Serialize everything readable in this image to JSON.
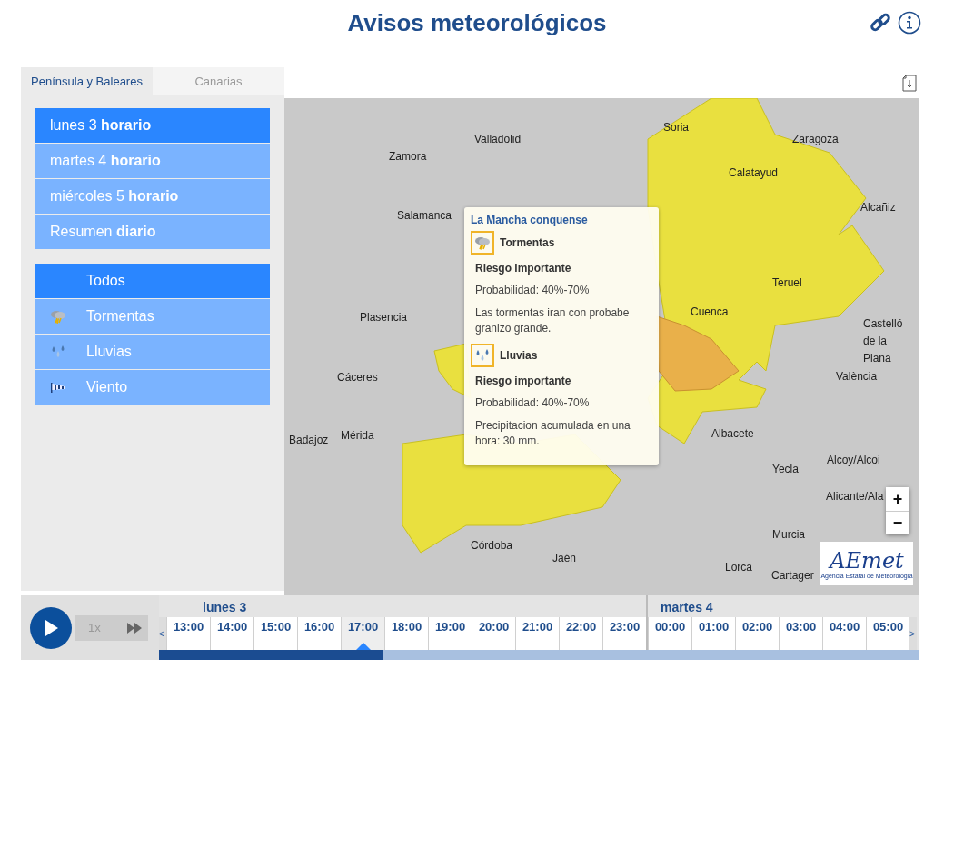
{
  "header": {
    "title": "Avisos meteorológicos"
  },
  "region_tabs": [
    {
      "label": "Península y Baleares",
      "selected": true
    },
    {
      "label": "Canarias",
      "selected": false
    }
  ],
  "day_list": [
    {
      "label": "lunes 3 **horario**",
      "selected": true
    },
    {
      "label": "martes 4 **horario**",
      "selected": false
    },
    {
      "label": "miércoles 5 **horario**",
      "selected": false
    },
    {
      "label": "Resumen **diario**",
      "selected": false
    }
  ],
  "phenomena": [
    {
      "kind": "all",
      "label": "Todos",
      "selected": true
    },
    {
      "kind": "storm",
      "label": "Tormentas",
      "selected": false
    },
    {
      "kind": "rain",
      "label": "Lluvias",
      "selected": false
    },
    {
      "kind": "wind",
      "label": "Viento",
      "selected": false
    }
  ],
  "map": {
    "cities": [
      "Soria",
      "Valladolid",
      "Zaragoza",
      "Zamora",
      "Calatayud",
      "Alcañiz",
      "Salamanca",
      "Teruel",
      "Cuenca",
      "Plasencia",
      "Castelló de la Plana",
      "València",
      "Cáceres",
      "Albacete",
      "Badajoz",
      "Mérida",
      "Alcoy/Alcoi",
      "Yecla",
      "Alicante/Ala",
      "Murcia",
      "Córdoba",
      "Jaén",
      "Lorca",
      "Cartager"
    ],
    "popup": {
      "title": "La Mancha conquense",
      "warnings": [
        {
          "kind": "storm",
          "name": "Tormentas",
          "risk": "Riesgo importante",
          "probability": "Probabilidad: 40%-70%",
          "description": "Las tormentas iran con probabe granizo grande."
        },
        {
          "kind": "rain",
          "name": "Lluvias",
          "risk": "Riesgo importante",
          "probability": "Probabilidad: 40%-70%",
          "description": "Precipitacion acumulada en una hora: 30 mm."
        }
      ]
    },
    "zoom_controls": [
      "+",
      "−"
    ],
    "logo": {
      "text": "AEmet",
      "subtitle": "Agencia Estatal de Meteorología"
    }
  },
  "timeline": {
    "speed": "1x",
    "prev": "<",
    "next": ">",
    "level": 0.295,
    "days": [
      {
        "label": "lunes 3",
        "hours": [
          {
            "label": "13:00",
            "selected": false
          },
          {
            "label": "14:00",
            "selected": false
          },
          {
            "label": "15:00",
            "selected": false
          },
          {
            "label": "16:00",
            "selected": false
          },
          {
            "label": "17:00",
            "selected": true
          },
          {
            "label": "18:00",
            "selected": false
          },
          {
            "label": "19:00",
            "selected": false
          },
          {
            "label": "20:00",
            "selected": false
          },
          {
            "label": "21:00",
            "selected": false
          },
          {
            "label": "22:00",
            "selected": false
          },
          {
            "label": "23:00",
            "selected": false
          }
        ]
      },
      {
        "label": "martes 4",
        "hours": [
          {
            "label": "00:00",
            "selected": false
          },
          {
            "label": "01:00",
            "selected": false
          },
          {
            "label": "02:00",
            "selected": false
          },
          {
            "label": "03:00",
            "selected": false
          },
          {
            "label": "04:00",
            "selected": false
          },
          {
            "label": "05:00",
            "selected": false
          }
        ]
      }
    ]
  }
}
